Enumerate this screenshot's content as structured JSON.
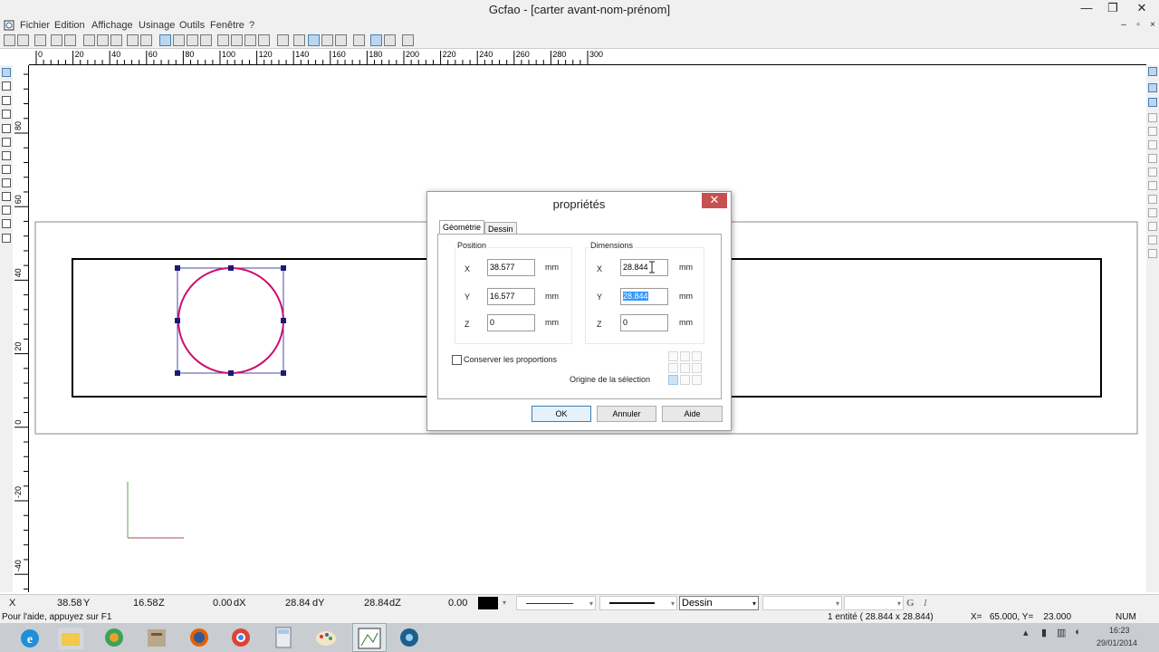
{
  "window": {
    "title": "Gcfao  - [carter avant-nom-prénom]",
    "minimize": "—",
    "restore": "❐",
    "close": "✕"
  },
  "menu": [
    "Fichier",
    "Edition",
    "Affichage",
    "Usinage",
    "Outils",
    "Fenêtre",
    "?"
  ],
  "ruler_h_labels": [
    "0",
    "20",
    "40",
    "60",
    "80",
    "100",
    "120",
    "140",
    "160",
    "180",
    "200",
    "220",
    "240",
    "260",
    "280",
    "300"
  ],
  "ruler_v_labels": [
    "80",
    "60",
    "40",
    "20",
    "0",
    "-20",
    "-40"
  ],
  "dialog": {
    "title": "propriétés",
    "tabs": [
      "Géométrie",
      "Dessin"
    ],
    "position": {
      "label": "Position",
      "x_label": "X",
      "x": "38.577",
      "y_label": "Y",
      "y": "16.577",
      "z_label": "Z",
      "z": "0"
    },
    "dimensions": {
      "label": "Dimensions",
      "x_label": "X",
      "x": "28.844",
      "y_label": "Y",
      "y": "28.844",
      "z_label": "Z",
      "z": "0"
    },
    "unit": "mm",
    "keep_proportions": {
      "label": "Conserver les proportions",
      "checked": false
    },
    "origin_label": "Origine de la sélection",
    "buttons": {
      "ok": "OK",
      "cancel": "Annuler",
      "help": "Aide"
    }
  },
  "status": {
    "x_label": "X",
    "x_value": "38.58",
    "y_label": "Y",
    "y_value": "16.58",
    "z_label": "Z",
    "z_value": "0.00",
    "dx_label": "dX",
    "dx_value": "28.84",
    "dy_label": "dY",
    "dy_value": "28.84",
    "dz_label": "dZ",
    "dz_value": "0.00",
    "layer": "Dessin",
    "bold_icon": "G",
    "italic_icon": "I"
  },
  "status2": {
    "help": "Pour l'aide, appuyez sur F1",
    "entity": "1 entité  (  28.844 x   28.844)",
    "coords": "X=   65.000, Y=    23.000",
    "num": "NUM"
  },
  "taskbar": {
    "time": "16:23",
    "date": "29/01/2014"
  },
  "colors": {
    "circle": "#cc0f6e",
    "handles": "#1a1a7a",
    "selection_box": "#4a4aaa",
    "axis_y": "#4cae4c",
    "axis_x": "#a05050"
  }
}
